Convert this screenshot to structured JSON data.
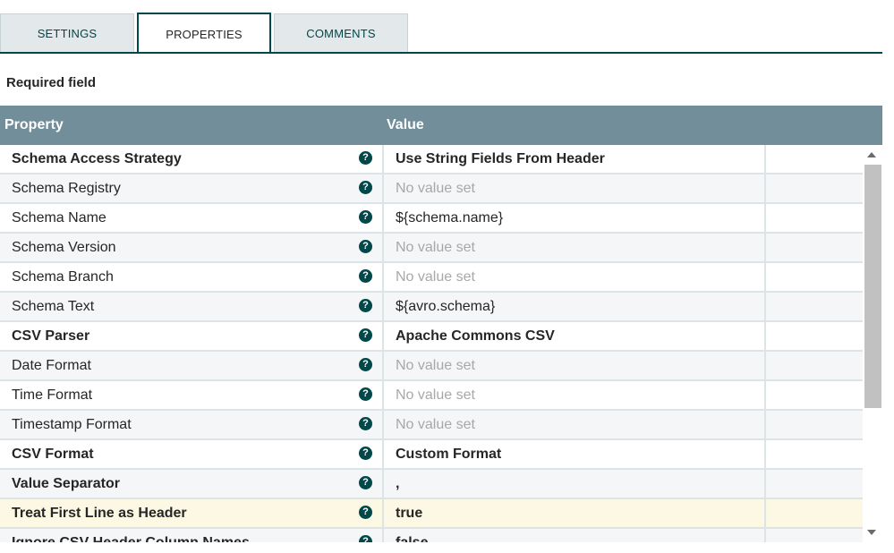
{
  "tabs": [
    {
      "label": "SETTINGS",
      "active": false
    },
    {
      "label": "PROPERTIES",
      "active": true
    },
    {
      "label": "COMMENTS",
      "active": false
    }
  ],
  "required_label": "Required field",
  "table": {
    "headers": {
      "property": "Property",
      "value": "Value"
    },
    "rows": [
      {
        "name": "Schema Access Strategy",
        "value": "Use String Fields From Header",
        "required": true,
        "value_set": true
      },
      {
        "name": "Schema Registry",
        "value": "No value set",
        "required": false,
        "value_set": false
      },
      {
        "name": "Schema Name",
        "value": "${schema.name}",
        "required": false,
        "value_set": true
      },
      {
        "name": "Schema Version",
        "value": "No value set",
        "required": false,
        "value_set": false
      },
      {
        "name": "Schema Branch",
        "value": "No value set",
        "required": false,
        "value_set": false
      },
      {
        "name": "Schema Text",
        "value": "${avro.schema}",
        "required": false,
        "value_set": true
      },
      {
        "name": "CSV Parser",
        "value": "Apache Commons CSV",
        "required": true,
        "value_set": true
      },
      {
        "name": "Date Format",
        "value": "No value set",
        "required": false,
        "value_set": false
      },
      {
        "name": "Time Format",
        "value": "No value set",
        "required": false,
        "value_set": false
      },
      {
        "name": "Timestamp Format",
        "value": "No value set",
        "required": false,
        "value_set": false
      },
      {
        "name": "CSV Format",
        "value": "Custom Format",
        "required": true,
        "value_set": true
      },
      {
        "name": "Value Separator",
        "value": ",",
        "required": true,
        "value_set": true
      },
      {
        "name": "Treat First Line as Header",
        "value": "true",
        "required": true,
        "value_set": true,
        "selected": true
      },
      {
        "name": "Ignore CSV Header Column Names",
        "value": "false",
        "required": true,
        "value_set": true
      }
    ]
  },
  "help_icon_glyph": "?",
  "colors": {
    "accent": "#004849",
    "header_bg": "#728e9b",
    "selected_row": "#fcf8e3",
    "unset_text": "#a8a8a8"
  }
}
